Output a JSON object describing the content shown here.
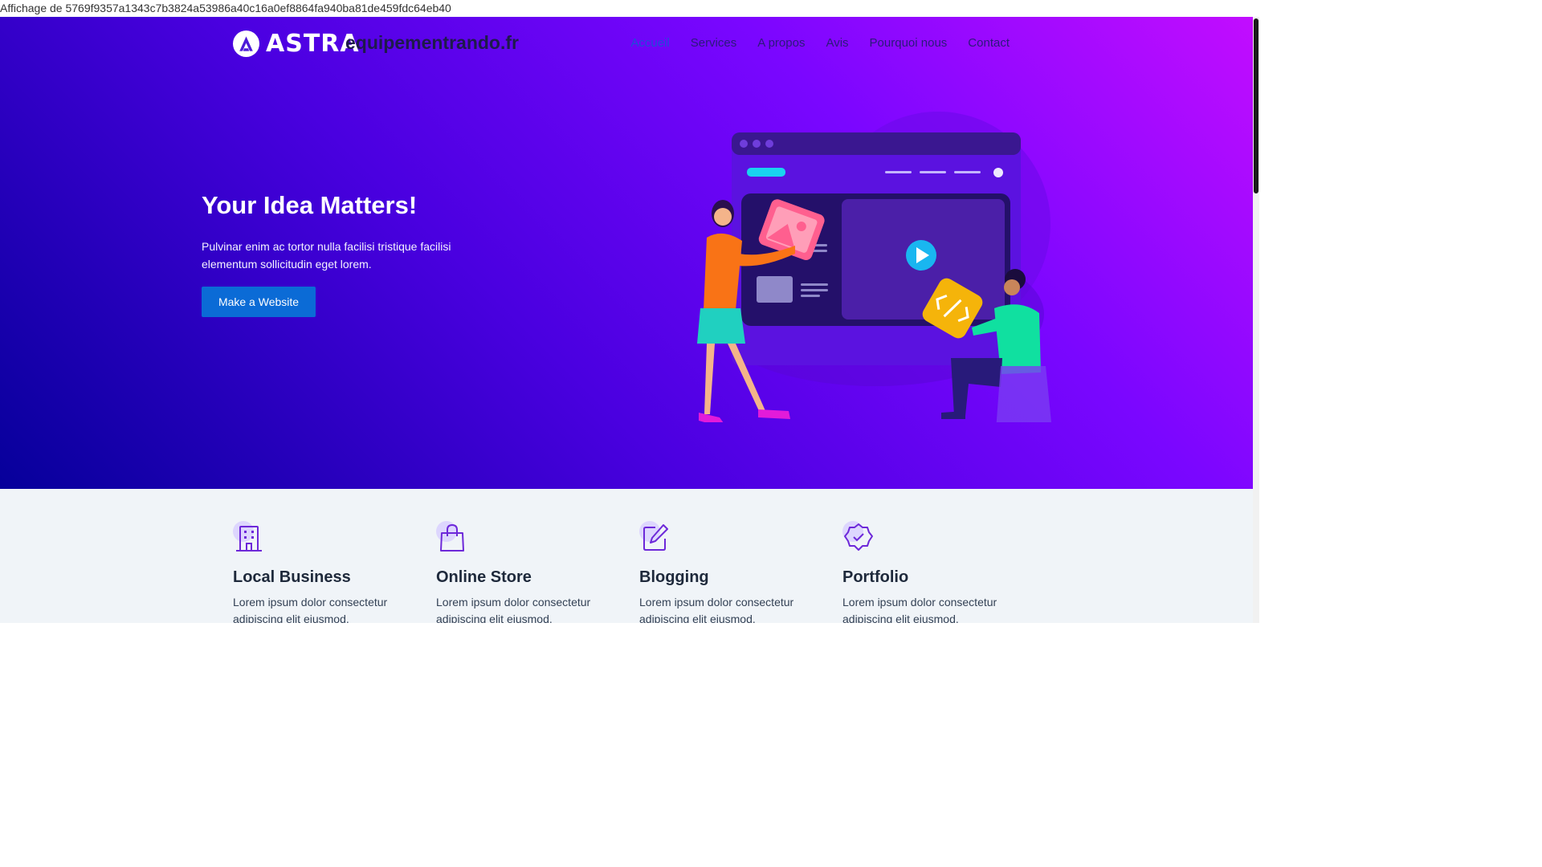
{
  "caption": "Affichage de 5769f9357a1343c7b3824a53986a40c16a0ef8864fa940ba81de459fdc64eb40",
  "header": {
    "logo_text": "ASTRA",
    "site_title": "equipementrando.fr",
    "nav": [
      {
        "label": "Accueil",
        "active": true
      },
      {
        "label": "Services"
      },
      {
        "label": "A propos"
      },
      {
        "label": "Avis"
      },
      {
        "label": "Pourquoi nous"
      },
      {
        "label": "Contact"
      }
    ]
  },
  "hero": {
    "title": "Your Idea Matters!",
    "description": "Pulvinar enim ac tortor nulla facilisi tristique facilisi elementum sollicitudin eget lorem.",
    "cta_label": "Make a Website"
  },
  "features": [
    {
      "icon": "building-icon",
      "title": "Local Business",
      "description": "Lorem ipsum dolor consectetur adipiscing elit eiusmod."
    },
    {
      "icon": "shopping-bag-icon",
      "title": "Online Store",
      "description": "Lorem ipsum dolor consectetur adipiscing elit eiusmod."
    },
    {
      "icon": "edit-icon",
      "title": "Blogging",
      "description": "Lorem ipsum dolor consectetur adipiscing elit eiusmod."
    },
    {
      "icon": "badge-check-icon",
      "title": "Portfolio",
      "description": "Lorem ipsum dolor consectetur adipiscing elit eiusmod."
    }
  ],
  "colors": {
    "accent": "#0b6bd6",
    "icon": "#6d28d9",
    "icon_bg": "#ddd6fe"
  }
}
